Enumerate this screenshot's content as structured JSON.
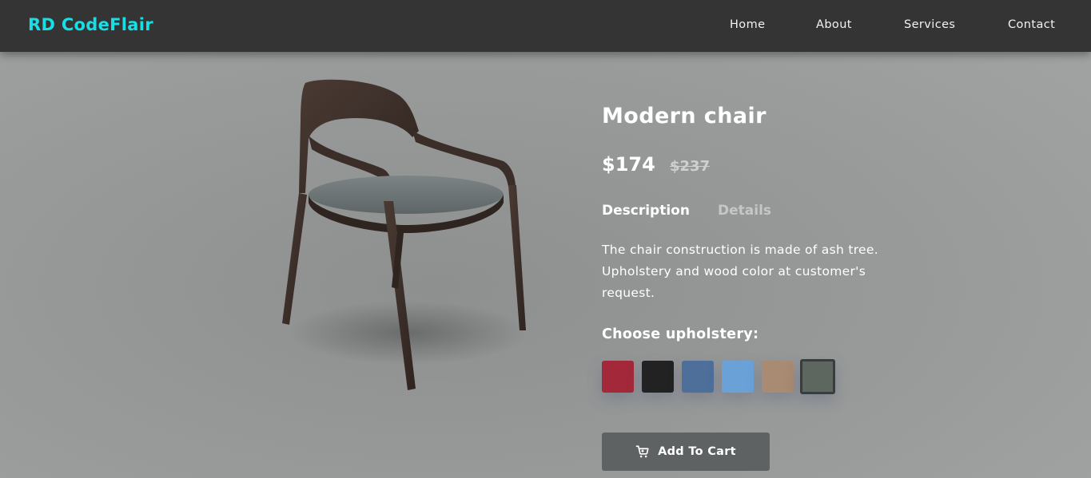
{
  "brand": "RD CodeFlair",
  "nav": {
    "items": [
      {
        "label": "Home"
      },
      {
        "label": "About"
      },
      {
        "label": "Services"
      },
      {
        "label": "Contact"
      }
    ]
  },
  "product": {
    "image_icon": "chair-image",
    "title": "Modern chair",
    "price": "$174",
    "old_price": "$237",
    "tabs": [
      {
        "label": "Description",
        "active": true
      },
      {
        "label": "Details",
        "active": false
      }
    ],
    "description": "The chair construction is made of ash tree. Upholstery and wood color at customer's request.",
    "upholstery_label": "Choose upholstery:",
    "swatches": [
      {
        "color": "#a3293a",
        "selected": false
      },
      {
        "color": "#222222",
        "selected": false
      },
      {
        "color": "#4d6f99",
        "selected": false
      },
      {
        "color": "#6aa2d8",
        "selected": false
      },
      {
        "color": "#a98a72",
        "selected": false
      },
      {
        "color": "#5e6660",
        "selected": true
      }
    ],
    "cart_button": {
      "label": "Add To Cart",
      "icon": "cart-icon"
    }
  },
  "colors": {
    "navbar": "#343434",
    "brand": "#17dfe6",
    "button": "#5f6262"
  }
}
